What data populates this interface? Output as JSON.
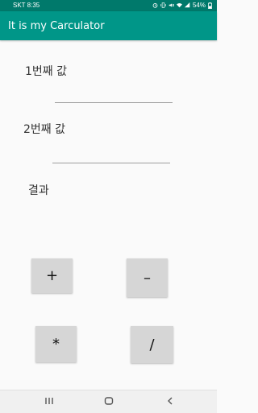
{
  "status_bar": {
    "carrier": "SKT",
    "time": "8:35",
    "battery": "54%",
    "icons": [
      "alarm-icon",
      "vibrate-icon",
      "mute-icon",
      "wifi-icon",
      "signal-icon",
      "battery-icon"
    ]
  },
  "app_bar": {
    "title": "It is my Carculator",
    "color": "#009688",
    "status_color": "#00796b"
  },
  "form": {
    "first_label": "1번째 값",
    "first_value": "",
    "second_label": "2번째 값",
    "second_value": "",
    "result_label": "결과"
  },
  "buttons": {
    "add": "+",
    "subtract": "–",
    "multiply": "*",
    "divide": "/"
  },
  "nav_bar": {
    "icons": [
      "recent-apps-icon",
      "home-icon",
      "back-icon"
    ]
  }
}
